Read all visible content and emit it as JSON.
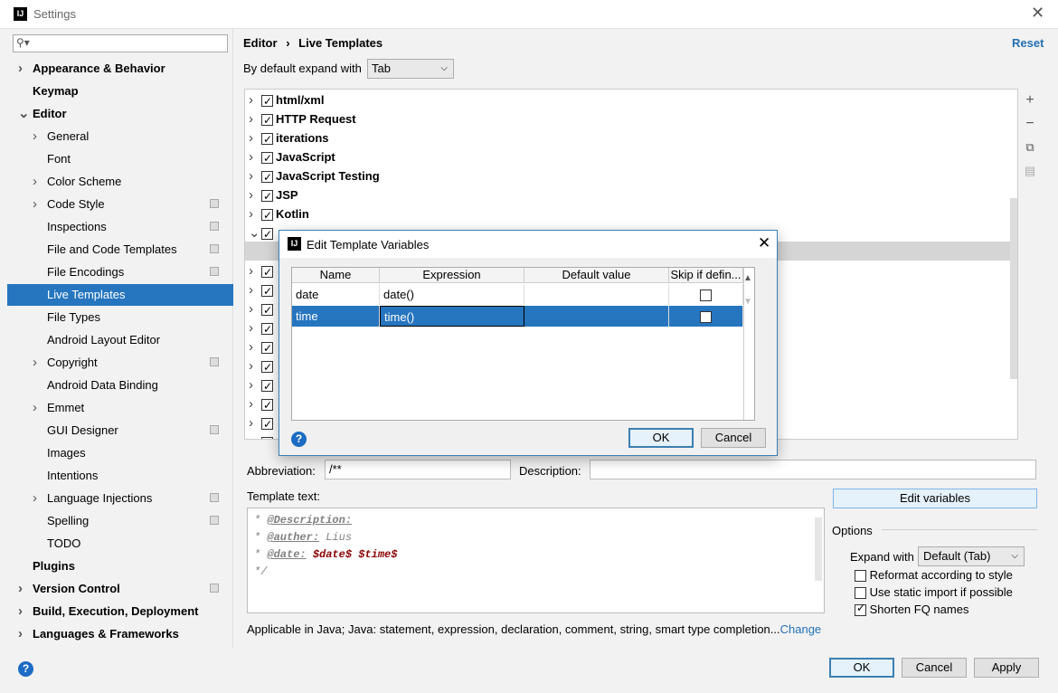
{
  "window": {
    "title": "Settings"
  },
  "sidebar": {
    "search_placeholder": "",
    "items": [
      {
        "label": "Appearance & Behavior",
        "level": 0,
        "bold": true,
        "arrow": "right"
      },
      {
        "label": "Keymap",
        "level": 0,
        "bold": true
      },
      {
        "label": "Editor",
        "level": 0,
        "bold": true,
        "arrow": "down"
      },
      {
        "label": "General",
        "level": 1,
        "arrow": "right"
      },
      {
        "label": "Font",
        "level": 1
      },
      {
        "label": "Color Scheme",
        "level": 1,
        "arrow": "right"
      },
      {
        "label": "Code Style",
        "level": 1,
        "arrow": "right",
        "proj": true
      },
      {
        "label": "Inspections",
        "level": 1,
        "proj": true
      },
      {
        "label": "File and Code Templates",
        "level": 1,
        "proj": true
      },
      {
        "label": "File Encodings",
        "level": 1,
        "proj": true
      },
      {
        "label": "Live Templates",
        "level": 1,
        "selected": true
      },
      {
        "label": "File Types",
        "level": 1
      },
      {
        "label": "Android Layout Editor",
        "level": 1
      },
      {
        "label": "Copyright",
        "level": 1,
        "arrow": "right",
        "proj": true
      },
      {
        "label": "Android Data Binding",
        "level": 1
      },
      {
        "label": "Emmet",
        "level": 1,
        "arrow": "right"
      },
      {
        "label": "GUI Designer",
        "level": 1,
        "proj": true
      },
      {
        "label": "Images",
        "level": 1
      },
      {
        "label": "Intentions",
        "level": 1
      },
      {
        "label": "Language Injections",
        "level": 1,
        "arrow": "right",
        "proj": true
      },
      {
        "label": "Spelling",
        "level": 1,
        "proj": true
      },
      {
        "label": "TODO",
        "level": 1
      },
      {
        "label": "Plugins",
        "level": 0,
        "bold": true
      },
      {
        "label": "Version Control",
        "level": 0,
        "bold": true,
        "arrow": "right",
        "proj": true
      },
      {
        "label": "Build, Execution, Deployment",
        "level": 0,
        "bold": true,
        "arrow": "right"
      },
      {
        "label": "Languages & Frameworks",
        "level": 0,
        "bold": true,
        "arrow": "right"
      }
    ]
  },
  "header": {
    "breadcrumb": [
      "Editor",
      "Live Templates"
    ],
    "separator": "›",
    "reset": "Reset"
  },
  "expand": {
    "label": "By default expand with",
    "value": "Tab"
  },
  "tree": {
    "groups": [
      "html/xml",
      "HTTP Request",
      "iterations",
      "JavaScript",
      "JavaScript Testing",
      "JSP",
      "Kotlin"
    ]
  },
  "toolbar": {
    "add": "+",
    "remove": "−",
    "copy": "⧉",
    "restore": "▤"
  },
  "abbreviation": {
    "label": "Abbreviation:",
    "value": "/**"
  },
  "description": {
    "label": "Description:",
    "value": ""
  },
  "template_text": {
    "label": "Template text:",
    "lines": [
      {
        "prefix": "* ",
        "tag": "@Description:",
        "rest": ""
      },
      {
        "prefix": "* ",
        "tag": "@auther:",
        "rest": " Lius"
      },
      {
        "prefix": "* ",
        "tag": "@date:",
        "rest": " ",
        "vars": "$date$ $time$"
      },
      {
        "prefix": "*/",
        "tag": "",
        "rest": ""
      }
    ]
  },
  "edit_variables": "Edit variables",
  "options": {
    "title": "Options",
    "expand_label": "Expand with",
    "expand_value": "Default (Tab)",
    "checks": [
      {
        "label": "Reformat according to style",
        "checked": false
      },
      {
        "label": "Use static import if possible",
        "checked": false
      },
      {
        "label": "Shorten FQ names",
        "checked": true
      }
    ]
  },
  "applicable": {
    "text": "Applicable in Java; Java: statement, expression, declaration, comment, string, smart type completion...",
    "link": "Change"
  },
  "footer": {
    "ok": "OK",
    "cancel": "Cancel",
    "apply": "Apply",
    "help": "?"
  },
  "dialog": {
    "title": "Edit Template Variables",
    "columns": [
      "Name",
      "Expression",
      "Default value",
      "Skip if defin..."
    ],
    "rows": [
      {
        "name": "date",
        "expression": "date()",
        "default": "",
        "skip": false
      },
      {
        "name": "time",
        "expression": "time()",
        "default": "",
        "skip": false,
        "selected": true
      }
    ],
    "ok": "OK",
    "cancel": "Cancel",
    "help": "?"
  },
  "colors": {
    "accent": "#2675bf",
    "link": "#2470b3",
    "variable": "#8b0000"
  }
}
